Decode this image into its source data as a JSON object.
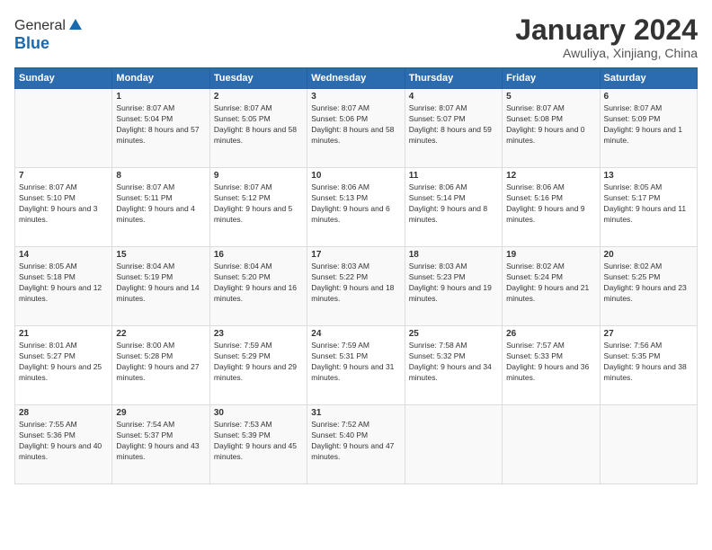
{
  "header": {
    "logo": {
      "line1": "General",
      "line2": "Blue"
    },
    "title": "January 2024",
    "location": "Awuliya, Xinjiang, China"
  },
  "weekdays": [
    "Sunday",
    "Monday",
    "Tuesday",
    "Wednesday",
    "Thursday",
    "Friday",
    "Saturday"
  ],
  "weeks": [
    [
      {
        "day": "",
        "sunrise": "",
        "sunset": "",
        "daylight": ""
      },
      {
        "day": "1",
        "sunrise": "Sunrise: 8:07 AM",
        "sunset": "Sunset: 5:04 PM",
        "daylight": "Daylight: 8 hours and 57 minutes."
      },
      {
        "day": "2",
        "sunrise": "Sunrise: 8:07 AM",
        "sunset": "Sunset: 5:05 PM",
        "daylight": "Daylight: 8 hours and 58 minutes."
      },
      {
        "day": "3",
        "sunrise": "Sunrise: 8:07 AM",
        "sunset": "Sunset: 5:06 PM",
        "daylight": "Daylight: 8 hours and 58 minutes."
      },
      {
        "day": "4",
        "sunrise": "Sunrise: 8:07 AM",
        "sunset": "Sunset: 5:07 PM",
        "daylight": "Daylight: 8 hours and 59 minutes."
      },
      {
        "day": "5",
        "sunrise": "Sunrise: 8:07 AM",
        "sunset": "Sunset: 5:08 PM",
        "daylight": "Daylight: 9 hours and 0 minutes."
      },
      {
        "day": "6",
        "sunrise": "Sunrise: 8:07 AM",
        "sunset": "Sunset: 5:09 PM",
        "daylight": "Daylight: 9 hours and 1 minute."
      }
    ],
    [
      {
        "day": "7",
        "sunrise": "Sunrise: 8:07 AM",
        "sunset": "Sunset: 5:10 PM",
        "daylight": "Daylight: 9 hours and 3 minutes."
      },
      {
        "day": "8",
        "sunrise": "Sunrise: 8:07 AM",
        "sunset": "Sunset: 5:11 PM",
        "daylight": "Daylight: 9 hours and 4 minutes."
      },
      {
        "day": "9",
        "sunrise": "Sunrise: 8:07 AM",
        "sunset": "Sunset: 5:12 PM",
        "daylight": "Daylight: 9 hours and 5 minutes."
      },
      {
        "day": "10",
        "sunrise": "Sunrise: 8:06 AM",
        "sunset": "Sunset: 5:13 PM",
        "daylight": "Daylight: 9 hours and 6 minutes."
      },
      {
        "day": "11",
        "sunrise": "Sunrise: 8:06 AM",
        "sunset": "Sunset: 5:14 PM",
        "daylight": "Daylight: 9 hours and 8 minutes."
      },
      {
        "day": "12",
        "sunrise": "Sunrise: 8:06 AM",
        "sunset": "Sunset: 5:16 PM",
        "daylight": "Daylight: 9 hours and 9 minutes."
      },
      {
        "day": "13",
        "sunrise": "Sunrise: 8:05 AM",
        "sunset": "Sunset: 5:17 PM",
        "daylight": "Daylight: 9 hours and 11 minutes."
      }
    ],
    [
      {
        "day": "14",
        "sunrise": "Sunrise: 8:05 AM",
        "sunset": "Sunset: 5:18 PM",
        "daylight": "Daylight: 9 hours and 12 minutes."
      },
      {
        "day": "15",
        "sunrise": "Sunrise: 8:04 AM",
        "sunset": "Sunset: 5:19 PM",
        "daylight": "Daylight: 9 hours and 14 minutes."
      },
      {
        "day": "16",
        "sunrise": "Sunrise: 8:04 AM",
        "sunset": "Sunset: 5:20 PM",
        "daylight": "Daylight: 9 hours and 16 minutes."
      },
      {
        "day": "17",
        "sunrise": "Sunrise: 8:03 AM",
        "sunset": "Sunset: 5:22 PM",
        "daylight": "Daylight: 9 hours and 18 minutes."
      },
      {
        "day": "18",
        "sunrise": "Sunrise: 8:03 AM",
        "sunset": "Sunset: 5:23 PM",
        "daylight": "Daylight: 9 hours and 19 minutes."
      },
      {
        "day": "19",
        "sunrise": "Sunrise: 8:02 AM",
        "sunset": "Sunset: 5:24 PM",
        "daylight": "Daylight: 9 hours and 21 minutes."
      },
      {
        "day": "20",
        "sunrise": "Sunrise: 8:02 AM",
        "sunset": "Sunset: 5:25 PM",
        "daylight": "Daylight: 9 hours and 23 minutes."
      }
    ],
    [
      {
        "day": "21",
        "sunrise": "Sunrise: 8:01 AM",
        "sunset": "Sunset: 5:27 PM",
        "daylight": "Daylight: 9 hours and 25 minutes."
      },
      {
        "day": "22",
        "sunrise": "Sunrise: 8:00 AM",
        "sunset": "Sunset: 5:28 PM",
        "daylight": "Daylight: 9 hours and 27 minutes."
      },
      {
        "day": "23",
        "sunrise": "Sunrise: 7:59 AM",
        "sunset": "Sunset: 5:29 PM",
        "daylight": "Daylight: 9 hours and 29 minutes."
      },
      {
        "day": "24",
        "sunrise": "Sunrise: 7:59 AM",
        "sunset": "Sunset: 5:31 PM",
        "daylight": "Daylight: 9 hours and 31 minutes."
      },
      {
        "day": "25",
        "sunrise": "Sunrise: 7:58 AM",
        "sunset": "Sunset: 5:32 PM",
        "daylight": "Daylight: 9 hours and 34 minutes."
      },
      {
        "day": "26",
        "sunrise": "Sunrise: 7:57 AM",
        "sunset": "Sunset: 5:33 PM",
        "daylight": "Daylight: 9 hours and 36 minutes."
      },
      {
        "day": "27",
        "sunrise": "Sunrise: 7:56 AM",
        "sunset": "Sunset: 5:35 PM",
        "daylight": "Daylight: 9 hours and 38 minutes."
      }
    ],
    [
      {
        "day": "28",
        "sunrise": "Sunrise: 7:55 AM",
        "sunset": "Sunset: 5:36 PM",
        "daylight": "Daylight: 9 hours and 40 minutes."
      },
      {
        "day": "29",
        "sunrise": "Sunrise: 7:54 AM",
        "sunset": "Sunset: 5:37 PM",
        "daylight": "Daylight: 9 hours and 43 minutes."
      },
      {
        "day": "30",
        "sunrise": "Sunrise: 7:53 AM",
        "sunset": "Sunset: 5:39 PM",
        "daylight": "Daylight: 9 hours and 45 minutes."
      },
      {
        "day": "31",
        "sunrise": "Sunrise: 7:52 AM",
        "sunset": "Sunset: 5:40 PM",
        "daylight": "Daylight: 9 hours and 47 minutes."
      },
      {
        "day": "",
        "sunrise": "",
        "sunset": "",
        "daylight": ""
      },
      {
        "day": "",
        "sunrise": "",
        "sunset": "",
        "daylight": ""
      },
      {
        "day": "",
        "sunrise": "",
        "sunset": "",
        "daylight": ""
      }
    ]
  ]
}
